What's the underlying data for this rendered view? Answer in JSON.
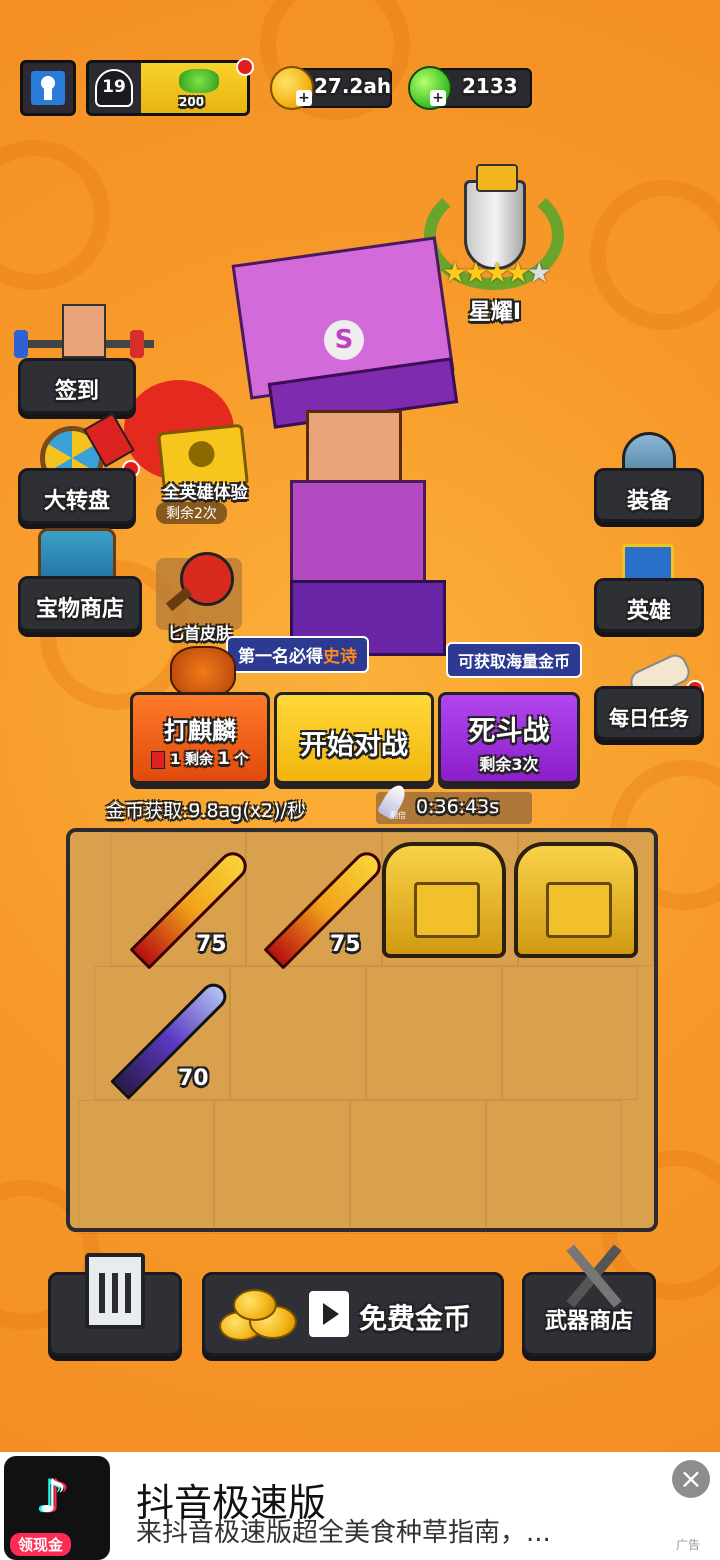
{
  "top_bar": {
    "level": "19",
    "xp_value": "200",
    "coins": "27.2ah",
    "gems": "2133"
  },
  "rank": {
    "label": "星耀Ⅰ"
  },
  "left_menu": {
    "checkin": "签到",
    "wheel": "大转盘",
    "shop": "宝物商店"
  },
  "right_menu": {
    "equip": "装备",
    "hero": "英雄",
    "daily": "每日任务"
  },
  "promo": {
    "all_hero_label": "全英雄体验",
    "all_hero_remaining": "剩余2次",
    "skin_label": "匕首皮肤"
  },
  "tooltips": {
    "first_place_prefix": "第一名必得",
    "first_place_highlight": "史诗",
    "coins_tip": "可获取海量金币"
  },
  "actions": {
    "qilin_label": "打麒麟",
    "qilin_sub_prefix": "1",
    "qilin_sub_text": "剩余",
    "qilin_sub_count": "1",
    "qilin_sub_unit": "个",
    "start_label": "开始对战",
    "deathmatch_label": "死斗战",
    "deathmatch_sub": "剩余3次"
  },
  "income": {
    "text": "金币获取:9.8ag(x2)/秒",
    "boost_label": "翻倍",
    "timer": "0:36:43s"
  },
  "grid": {
    "items": [
      {
        "type": "sword-red",
        "level": "75"
      },
      {
        "type": "sword-red",
        "level": "75"
      },
      {
        "type": "chest",
        "level": ""
      },
      {
        "type": "chest",
        "level": ""
      },
      {
        "type": "sword-purple",
        "level": "70"
      }
    ]
  },
  "bottom": {
    "free_coins": "免费金币",
    "weapon_shop": "武器商店"
  },
  "ad": {
    "title": "抖音极速版",
    "desc": "来抖音极速版超全美食种草指南，...",
    "badge": "领现金",
    "ad_label": "广告"
  },
  "colors": {
    "background": "#f79a2a",
    "qilin_btn": "#f05a14",
    "start_btn": "#f8c416",
    "deathmatch_btn": "#9b27d8",
    "grid_bg": "#d89a47"
  }
}
